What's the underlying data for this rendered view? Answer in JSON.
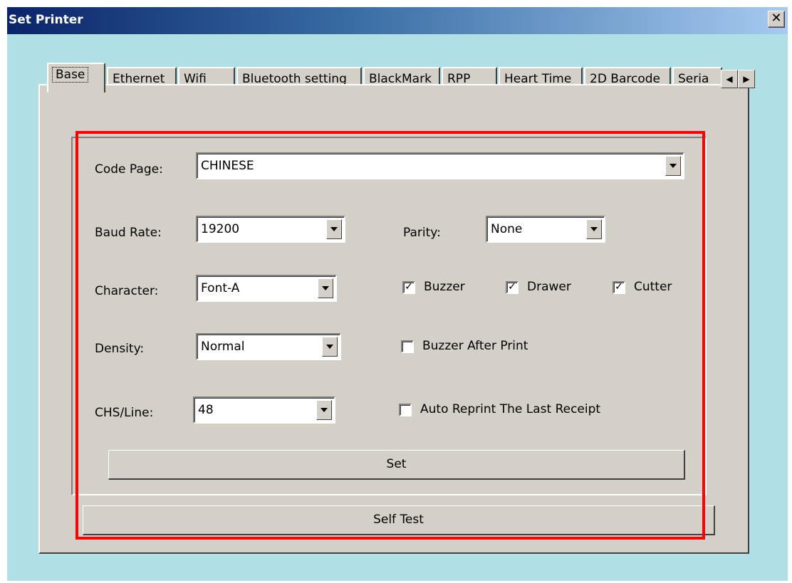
{
  "window": {
    "title": "Set Printer",
    "close_glyph": "✕"
  },
  "tabs": [
    {
      "label": "Base",
      "active": true
    },
    {
      "label": "Ethernet"
    },
    {
      "label": "Wifi"
    },
    {
      "label": "Bluetooth setting"
    },
    {
      "label": "BlackMark"
    },
    {
      "label": "RPP"
    },
    {
      "label": "Heart Time"
    },
    {
      "label": "2D Barcode"
    },
    {
      "label": "Seria"
    }
  ],
  "tab_scroll": {
    "left": "◀",
    "right": "▶"
  },
  "form": {
    "code_page": {
      "label": "Code Page:",
      "value": "CHINESE"
    },
    "baud_rate": {
      "label": "Baud Rate:",
      "value": "19200"
    },
    "parity": {
      "label": "Parity:",
      "value": "None"
    },
    "character": {
      "label": "Character:",
      "value": "Font-A"
    },
    "density": {
      "label": "Density:",
      "value": "Normal"
    },
    "chs_line": {
      "label": "CHS/Line:",
      "value": "48"
    },
    "checkboxes": {
      "buzzer": {
        "label": "Buzzer",
        "checked": true,
        "mark": "✓"
      },
      "drawer": {
        "label": "Drawer",
        "checked": true,
        "mark": "✓"
      },
      "cutter": {
        "label": "Cutter",
        "checked": true,
        "mark": "✓"
      },
      "buzzer_after_print": {
        "label": "Buzzer After Print",
        "checked": false,
        "mark": ""
      },
      "auto_reprint": {
        "label": "Auto Reprint The Last Receipt",
        "checked": false,
        "mark": ""
      }
    },
    "set_button": "Set",
    "self_test_button": "Self Test"
  },
  "colors": {
    "highlight": "#ff0000",
    "client_bg": "#b0e0e6",
    "panel_bg": "#d4d0c8"
  }
}
